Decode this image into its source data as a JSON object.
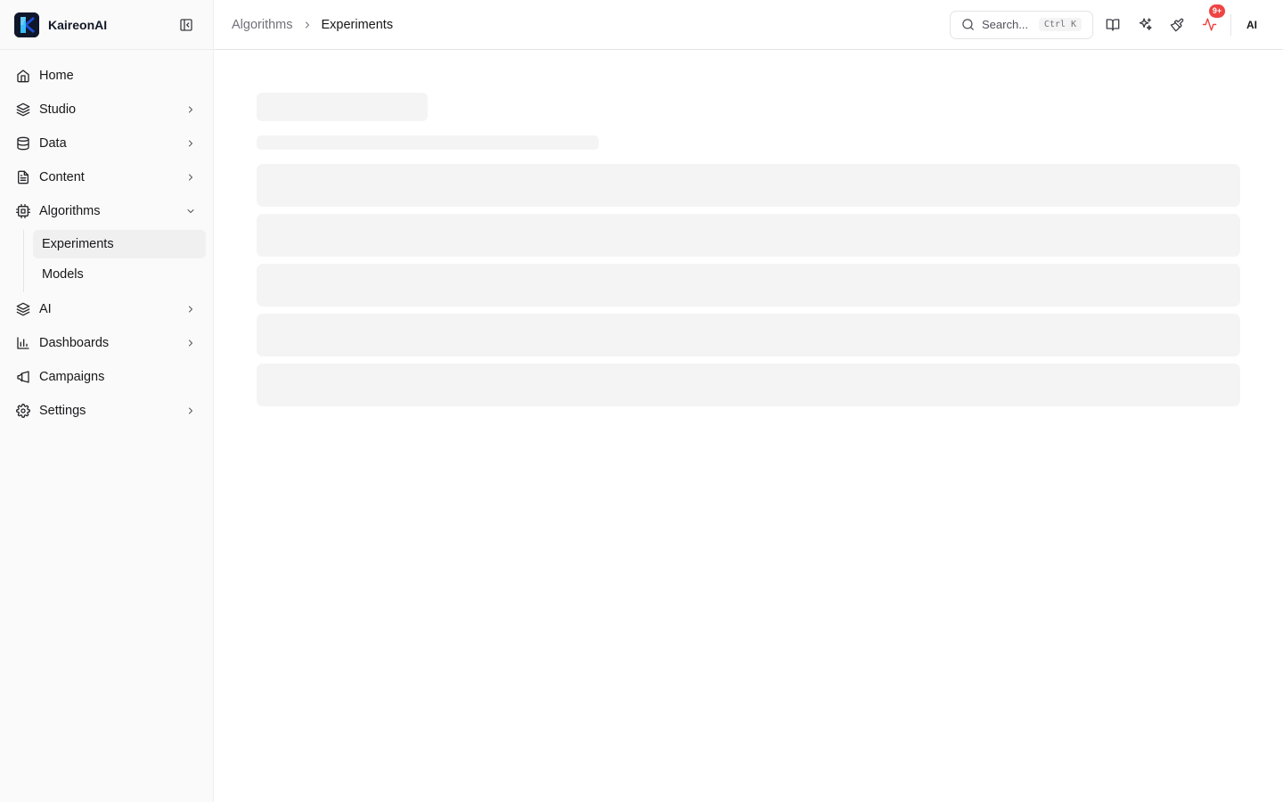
{
  "app": {
    "name": "KaireonAI"
  },
  "sidebar": {
    "items": [
      {
        "label": "Home",
        "icon": "home-icon",
        "has_children": false
      },
      {
        "label": "Studio",
        "icon": "layers-icon",
        "has_children": true
      },
      {
        "label": "Data",
        "icon": "database-icon",
        "has_children": true
      },
      {
        "label": "Content",
        "icon": "file-text-icon",
        "has_children": true
      },
      {
        "label": "Algorithms",
        "icon": "cpu-icon",
        "has_children": true,
        "expanded": true,
        "children": [
          {
            "label": "Experiments",
            "active": true
          },
          {
            "label": "Models",
            "active": false
          }
        ]
      },
      {
        "label": "AI",
        "icon": "layers-icon",
        "has_children": true
      },
      {
        "label": "Dashboards",
        "icon": "bar-chart-icon",
        "has_children": true
      },
      {
        "label": "Campaigns",
        "icon": "megaphone-icon",
        "has_children": false
      },
      {
        "label": "Settings",
        "icon": "gear-icon",
        "has_children": true
      }
    ]
  },
  "breadcrumb": {
    "parent": "Algorithms",
    "current": "Experiments"
  },
  "topbar": {
    "search_placeholder": "Search...",
    "search_shortcut": "Ctrl K",
    "notifications_badge": "9+",
    "avatar_initials": "AI"
  },
  "colors": {
    "badge": "#ef4444",
    "skeleton": "#f4f4f5",
    "sidebar_bg": "#fafafa",
    "active_item_bg": "#f0f0f1"
  }
}
